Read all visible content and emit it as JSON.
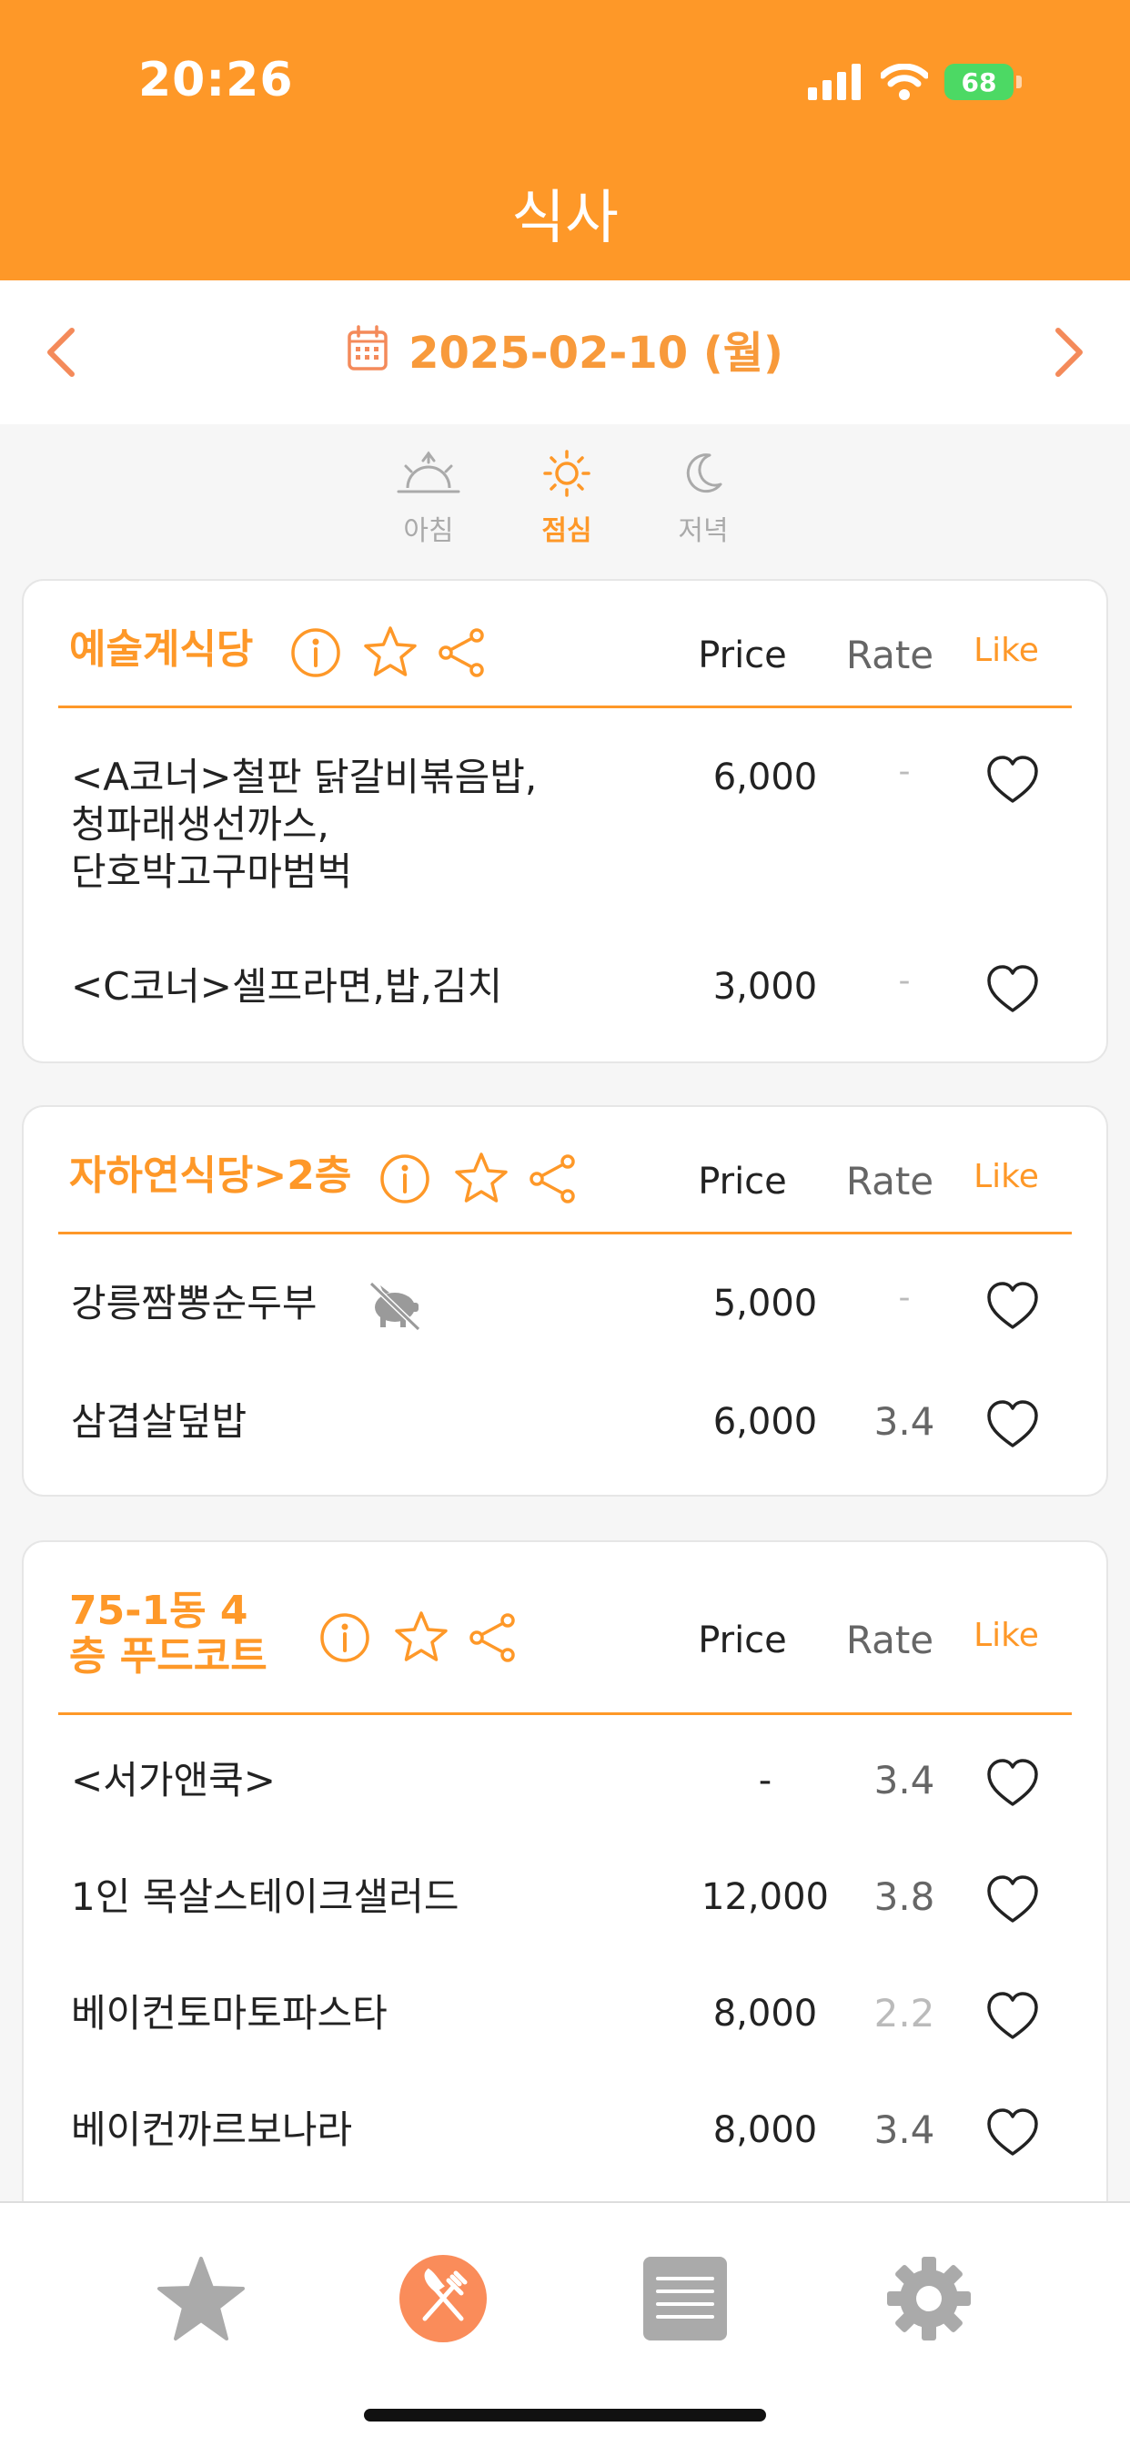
{
  "status": {
    "time": "20:26",
    "battery": "68"
  },
  "header": {
    "title": "식사"
  },
  "date_bar": {
    "date": "2025-02-10 (월)"
  },
  "meal_tabs": [
    {
      "label": "아침",
      "icon": "sunrise-icon",
      "active": false
    },
    {
      "label": "점심",
      "icon": "sun-icon",
      "active": true
    },
    {
      "label": "저녁",
      "icon": "moon-icon",
      "active": false
    }
  ],
  "columns": {
    "price": "Price",
    "rate": "Rate",
    "like": "Like"
  },
  "restaurants": [
    {
      "name": "예술계식당",
      "items": [
        {
          "name": "<A코너>철판 닭갈비볶음밥,\n청파래생선까스,\n단호박고구마범벅",
          "price": "6,000",
          "rate": "-"
        },
        {
          "name": "<C코너>셀프라면,밥,김치",
          "price": "3,000",
          "rate": "-"
        }
      ]
    },
    {
      "name": "자하연식당>2층",
      "items": [
        {
          "name": "강릉짬뽕순두부",
          "price": "5,000",
          "rate": "-",
          "icon": "no-pork-icon"
        },
        {
          "name": "삼겹살덮밥",
          "price": "6,000",
          "rate": "3.4"
        }
      ]
    },
    {
      "name_line1": "75-1동 4",
      "name_line2": "층 푸드코트",
      "items": [
        {
          "name": "<서가앤쿡>",
          "price": "-",
          "rate": "3.4"
        },
        {
          "name": "1인 목살스테이크샐러드",
          "price": "12,000",
          "rate": "3.8"
        },
        {
          "name": "베이컨토마토파스타",
          "price": "8,000",
          "rate": "2.2"
        },
        {
          "name": "베이컨까르보나라",
          "price": "8,000",
          "rate": "3.4"
        }
      ]
    }
  ],
  "tabbar": [
    {
      "icon": "star-icon",
      "active": false
    },
    {
      "icon": "fork-knife-icon",
      "active": true
    },
    {
      "icon": "list-icon",
      "active": false
    },
    {
      "icon": "gear-icon",
      "active": false
    }
  ],
  "colors": {
    "accent": "#fe9828",
    "header": "#fe9828",
    "text": "#222222",
    "inactive": "#aaaaaa"
  }
}
